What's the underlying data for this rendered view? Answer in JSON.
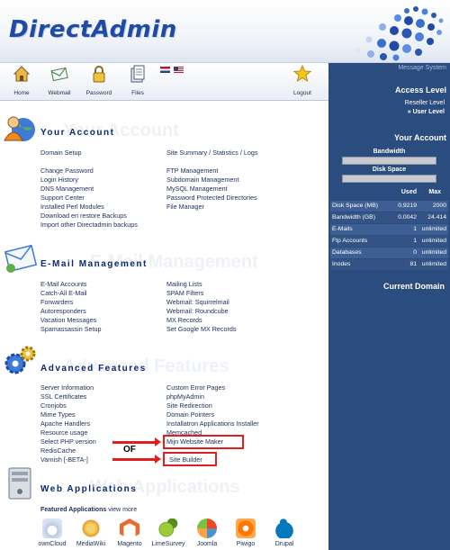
{
  "header": {
    "logo": "DirectAdmin"
  },
  "toolbar": {
    "home": "Home",
    "webmail": "Webmail",
    "password": "Password",
    "files": "Files",
    "logout": "Logout",
    "icons": [
      "house-icon",
      "envelope-icon",
      "lock-icon",
      "files-icon",
      "star-icon"
    ]
  },
  "sidebar": {
    "system": "Message System",
    "access_level": "Access Level",
    "reseller_level": "Reseller Level",
    "user_level": "» User Level",
    "your_account": "Your Account",
    "bandwidth_label": "Bandwidth",
    "disk_space_label": "Disk Space",
    "bandwidth_fill": 0.0,
    "disk_fill": 0.0,
    "stats_headers": {
      "used": "Used",
      "max": "Max"
    },
    "stats": [
      {
        "label": "Disk Space (MB)",
        "used": "0.9219",
        "max": "2000"
      },
      {
        "label": "Bandwidth (GB)",
        "used": "0.0042",
        "max": "24.414"
      },
      {
        "label": "E-Mails",
        "used": "1",
        "max": "unlimited"
      },
      {
        "label": "Ftp Accounts",
        "used": "1",
        "max": "unlimited"
      },
      {
        "label": "Databases",
        "used": "0",
        "max": "unlimited"
      },
      {
        "label": "Inodes",
        "used": "81",
        "max": "unlimited"
      }
    ],
    "current_domain": "Current Domain"
  },
  "account": {
    "title": "Your Account",
    "col1": [
      "Domain Setup",
      "",
      "Change Password",
      "Login History",
      "DNS Management",
      "Support Center",
      "Installed Perl Modules",
      "Download en restore Backups",
      "Import other Directadmin backups"
    ],
    "col2": [
      "Site Summary / Statistics / Logs",
      "",
      "FTP Management",
      "Subdomain Management",
      "MySQL Management",
      "Password Protected Directories",
      "File Manager"
    ]
  },
  "email": {
    "title": "E-Mail Management",
    "col1": [
      "E-Mail Accounts",
      "Catch-All E-Mail",
      "Forwarders",
      "Autoresponders",
      "Vacation Messages",
      "Spamassassin Setup"
    ],
    "col2": [
      "Mailing Lists",
      "SPAM Filters",
      "Webmail: Squirrelmail",
      "Webmail: Roundcube",
      "MX Records",
      "Set Google MX Records"
    ]
  },
  "advanced": {
    "title": "Advanced Features",
    "col1": [
      "Server Information",
      "SSL Certificates",
      "Cronjobs",
      "Mime Types",
      "Apache Handlers",
      "Resource usage",
      "Select PHP version",
      "RedisCache",
      "Varnish [-BETA-]"
    ],
    "col2": [
      "Custom Error Pages",
      "phpMyAdmin",
      "Site Redirection",
      "Domain Pointers",
      "Installatron Applications Installer",
      "Memcached",
      "Mijn Website Maker",
      "",
      "Site Builder"
    ]
  },
  "annotation": {
    "of": "OF"
  },
  "web_apps": {
    "title": "Web Applications",
    "featured": "Featured Applications",
    "view_more": "view more",
    "apps": [
      "ownCloud",
      "MediaWiki",
      "Magento",
      "LimeSurvey",
      "Joomla",
      "Piwigo",
      "Drupal"
    ]
  },
  "colors": {
    "sidebar": "#2b4c7e",
    "accent": "#e31e1e",
    "link": "#1a2f5a"
  }
}
